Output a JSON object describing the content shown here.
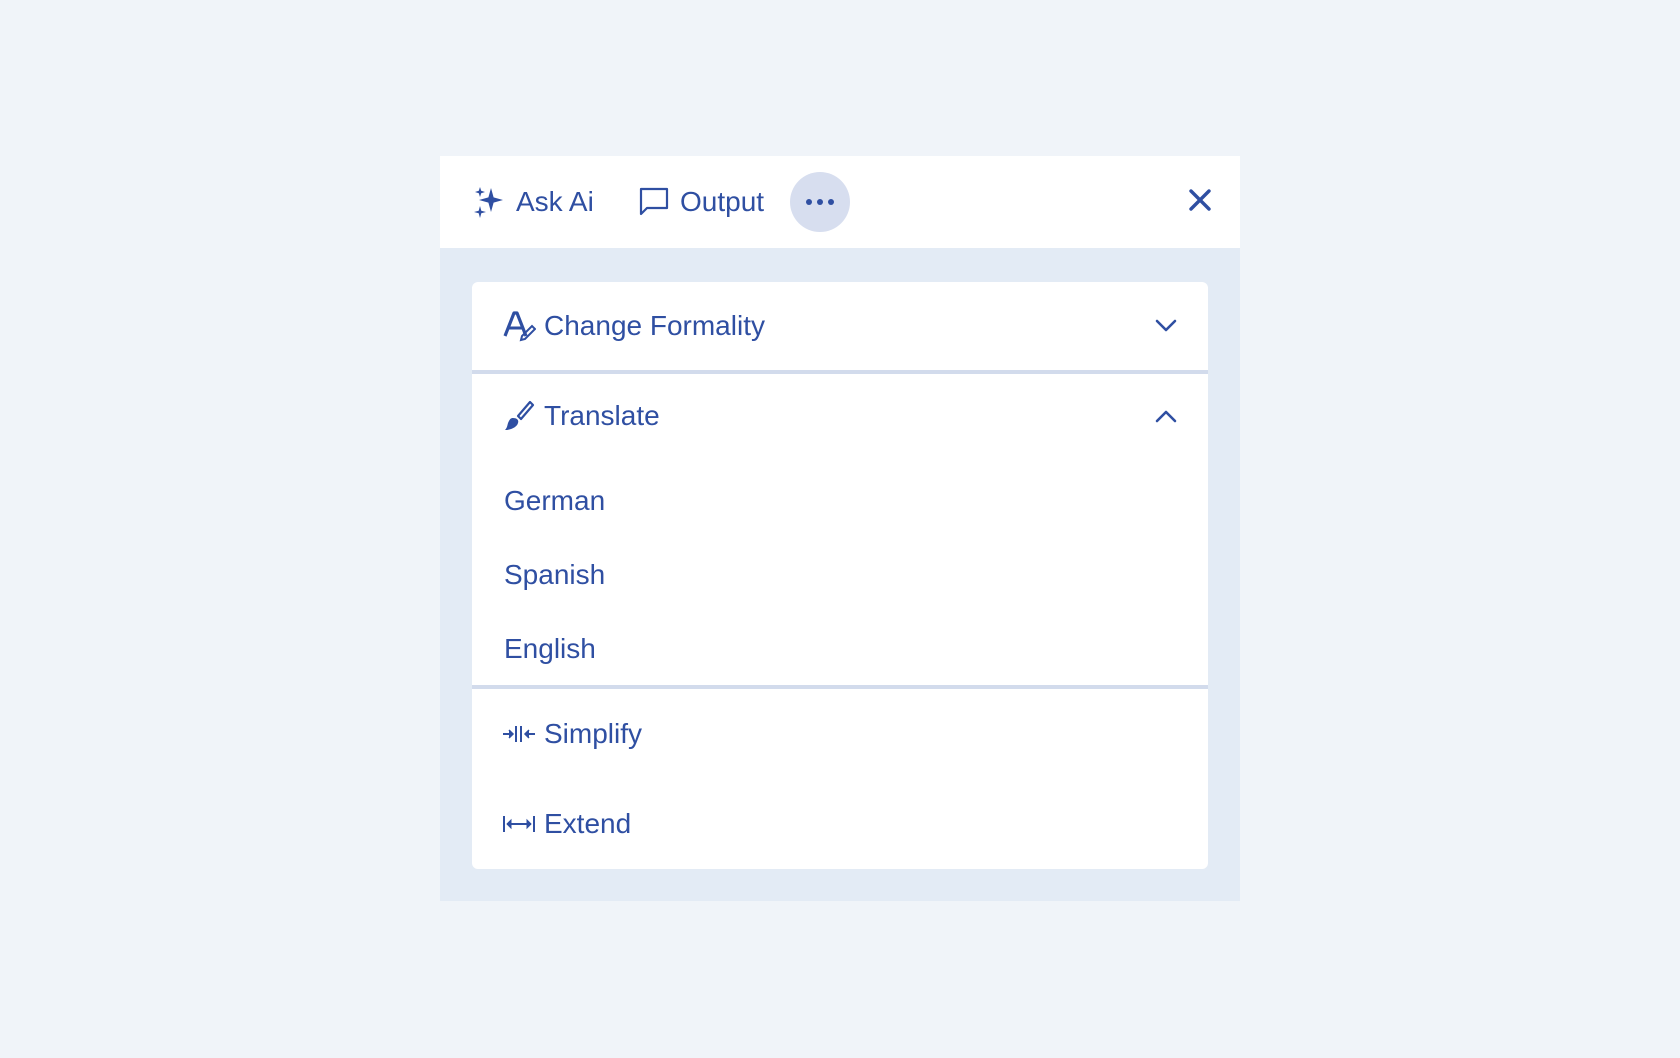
{
  "topbar": {
    "ask_ai_label": "Ask Ai",
    "output_label": "Output",
    "more_icon": "ellipsis-icon",
    "close_icon": "close-icon"
  },
  "menu": {
    "change_formality": {
      "label": "Change Formality",
      "icon": "text-edit-icon",
      "state": "collapsed"
    },
    "translate": {
      "label": "Translate",
      "icon": "brush-icon",
      "state": "expanded",
      "options": [
        "German",
        "Spanish",
        "English"
      ]
    },
    "simplify": {
      "label": "Simplify",
      "icon": "compress-horizontal-icon"
    },
    "extend": {
      "label": "Extend",
      "icon": "expand-horizontal-icon"
    }
  },
  "colors": {
    "accent": "#2f4fa2",
    "background": "#f0f4f9",
    "panel": "#e3ebf5",
    "more_button_bg": "#d7deef",
    "divider": "#d2dbec"
  }
}
